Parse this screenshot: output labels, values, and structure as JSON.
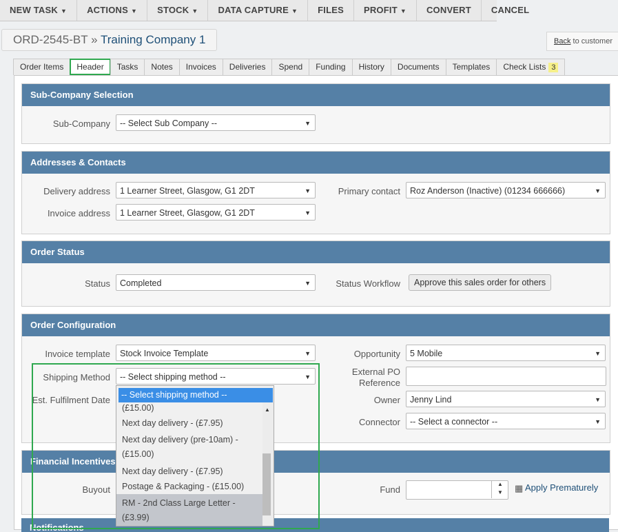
{
  "toolbar": {
    "items": [
      {
        "label": "NEW TASK",
        "dropdown": true
      },
      {
        "label": "ACTIONS",
        "dropdown": true
      },
      {
        "label": "STOCK",
        "dropdown": true
      },
      {
        "label": "DATA CAPTURE",
        "dropdown": true
      },
      {
        "label": "FILES",
        "dropdown": false
      },
      {
        "label": "PROFIT",
        "dropdown": true
      },
      {
        "label": "CONVERT",
        "dropdown": false
      },
      {
        "label": "CANCEL",
        "dropdown": false
      }
    ]
  },
  "order": {
    "code": "ORD-2545-BT",
    "separator": "»",
    "company": "Training Company 1"
  },
  "back": {
    "link": "Back",
    "rest": " to customer"
  },
  "tabs": [
    {
      "label": "Order Items"
    },
    {
      "label": "Header",
      "active": true
    },
    {
      "label": "Tasks"
    },
    {
      "label": "Notes"
    },
    {
      "label": "Invoices"
    },
    {
      "label": "Deliveries"
    },
    {
      "label": "Spend"
    },
    {
      "label": "Funding"
    },
    {
      "label": "History"
    },
    {
      "label": "Documents"
    },
    {
      "label": "Templates"
    },
    {
      "label": "Check Lists",
      "badge": "3"
    }
  ],
  "sub_company": {
    "title": "Sub-Company Selection",
    "label": "Sub-Company",
    "value": "-- Select Sub Company --"
  },
  "addresses": {
    "title": "Addresses & Contacts",
    "delivery_label": "Delivery address",
    "delivery_value": "1 Learner Street, Glasgow, G1 2DT",
    "invoice_label": "Invoice address",
    "invoice_value": "1 Learner Street, Glasgow, G1 2DT",
    "contact_label": "Primary contact",
    "contact_value": "Roz Anderson (Inactive) (01234 666666)"
  },
  "status": {
    "title": "Order Status",
    "label": "Status",
    "value": "Completed",
    "workflow_label": "Status Workflow",
    "workflow_button": "Approve this sales order for others"
  },
  "config": {
    "title": "Order Configuration",
    "invoice_template_label": "Invoice template",
    "invoice_template_value": "Stock Invoice Template",
    "shipping_label": "Shipping Method",
    "shipping_value": "-- Select shipping method --",
    "fulfilment_label": "Est. Fulfilment Date",
    "opportunity_label": "Opportunity",
    "opportunity_value": "5 Mobile",
    "po_label_1": "External PO",
    "po_label_2": "Reference",
    "owner_label": "Owner",
    "owner_value": "Jenny Lind",
    "connector_label": "Connector",
    "connector_value": "-- Select a connector --"
  },
  "shipping_dropdown": {
    "selected": "-- Select shipping method --",
    "options": [
      "(£15.00)",
      "Next day delivery - (£7.95)",
      "Next day delivery (pre-10am) - (£15.00)",
      "Next day delivery - (£7.95)",
      "Postage & Packaging - (£15.00)",
      "RM - 2nd Class Large Letter - (£3.99)"
    ],
    "highlighted_index": 5
  },
  "financial": {
    "title": "Financial Incentives",
    "buyout_label": "Buyout",
    "fund_label": "Fund",
    "apply_label": "Apply Prematurely"
  },
  "notifications": {
    "title": "Notifications"
  },
  "colors": {
    "panel_header": "#5580a6",
    "highlight_green": "#2fa84f",
    "dropdown_selected": "#3a8ee6",
    "link": "#1e4f77"
  }
}
